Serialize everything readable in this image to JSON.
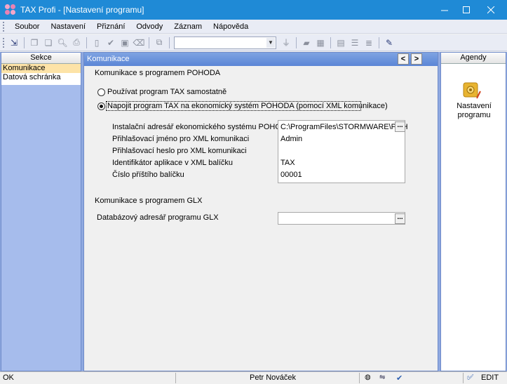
{
  "window": {
    "title": "TAX Profi - [Nastavení programu]",
    "controls": [
      "minimize-icon",
      "maximize-icon",
      "close-icon"
    ]
  },
  "menu": [
    {
      "label": "Soubor"
    },
    {
      "label": "Nastavení"
    },
    {
      "label": "Přiznání"
    },
    {
      "label": "Odvody"
    },
    {
      "label": "Záznam"
    },
    {
      "label": "Nápověda"
    }
  ],
  "toolbar": {
    "combo_value": ""
  },
  "left_panel": {
    "title": "Sekce",
    "items": [
      {
        "label": "Komunikace",
        "selected": true
      },
      {
        "label": "Datová schránka",
        "selected": false
      }
    ]
  },
  "center": {
    "header": "Komunikace",
    "pohoda_section": "Komunikace s programem POHODA",
    "radio_standalone": "Používat program TAX samostatně",
    "radio_connect": "Napojit program TAX na ekonomický systém POHODA (pomocí XML komunikace)",
    "fields": {
      "install_label": "Instalační adresář ekonomického systému POHODA",
      "install_value": "C:\\ProgramFiles\\STORMWARE\\POH",
      "login_label": "Přihlašovací jméno pro XML komunikaci",
      "login_value": "Admin",
      "password_label": "Přihlašovací heslo pro XML komunikaci",
      "password_value": "",
      "appid_label": "Identifikátor aplikace v XML balíčku",
      "appid_value": "TAX",
      "packet_label": "Číslo příštího balíčku",
      "packet_value": "00001"
    },
    "glx_section": "Komunikace s programem GLX",
    "glx_label": "Databázový adresář programu GLX",
    "glx_value": "",
    "ellipsis": "..."
  },
  "right_panel": {
    "title": "Agendy",
    "item_label": "Nastavení programu"
  },
  "status": {
    "left": "OK",
    "user": "Petr Nováček",
    "mode": "EDIT"
  },
  "colors": {
    "titlebar": "#1f8ad6",
    "panel_bg": "#8fa9e0",
    "selected_item": "#fde3a7",
    "header_blue": "#5b86d6"
  }
}
